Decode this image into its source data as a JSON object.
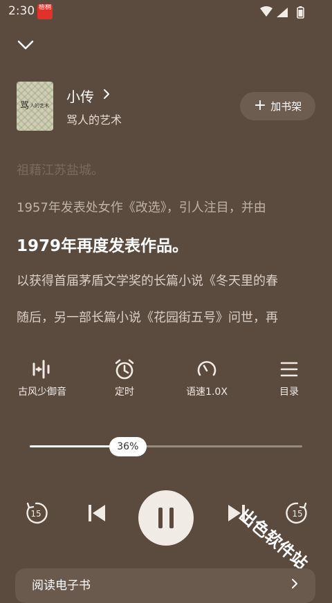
{
  "status_bar": {
    "time": "2:30",
    "app_icon_label": "梧桐"
  },
  "book": {
    "cover_title": "骂",
    "cover_subtitle": "人的艺术",
    "title": "小传",
    "subtitle": "骂人的艺术",
    "add_shelf_label": "加书架"
  },
  "text_lines": [
    "祖藉江苏盐城。",
    "1957年发表处女作《改选》，引人注目，并由",
    "1979年再度发表作品。",
    "以获得首届茅盾文学奖的长篇小说《冬天里的春",
    "随后，另一部长篇小说《花园街五号》问世，再"
  ],
  "controls": [
    {
      "label": "古风少御音",
      "icon": "voice-wave-icon"
    },
    {
      "label": "定时",
      "icon": "alarm-clock-icon"
    },
    {
      "label": "语速1.0X",
      "icon": "speed-gauge-icon"
    },
    {
      "label": "目录",
      "icon": "menu-list-icon"
    }
  ],
  "progress": {
    "percent": 36,
    "label": "36%"
  },
  "playback": {
    "rewind_seconds": "15",
    "forward_seconds": "15",
    "state": "playing"
  },
  "bottom": {
    "read_ebook_label": "阅读电子书"
  },
  "watermark": "出色软件站",
  "colors": {
    "background": "#5b4a3e",
    "accent": "#f1ebe5",
    "app_icon": "#e2312a"
  }
}
